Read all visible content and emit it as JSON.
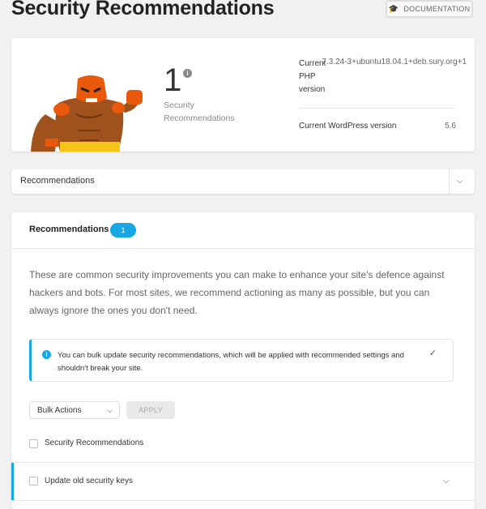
{
  "page": {
    "title": "Security Recommendations"
  },
  "header": {
    "documentation_label": "DOCUMENTATION"
  },
  "summary": {
    "count": "1",
    "count_label": "Security Recommendations",
    "php_label": "Current PHP version",
    "php_value": "7.3.24-3+ubuntu18.04.1+deb.sury.org+1",
    "wp_label": "Current WordPress version",
    "wp_value": "5.6"
  },
  "filter_dropdown": {
    "label": "Recommendations"
  },
  "recommendations": {
    "title": "Recommendations",
    "badge": "1",
    "description": "These are common security improvements you can make to enhance your site's defence against hackers and bots. For most sites, we recommend actioning as many as possible, but you can always ignore the ones you don't need.",
    "notice": "You can bulk update security recommendations, which will be applied with recommended settings and shouldn't break your site.",
    "bulk_actions": "Bulk Actions",
    "apply_label": "APPLY",
    "header_row_label": "Security Recommendations",
    "items": [
      {
        "label": "Update old security keys"
      }
    ]
  },
  "colors": {
    "accent": "#17a8e3",
    "hero_orange": "#e8590c",
    "hero_skin": "#a0521d"
  }
}
